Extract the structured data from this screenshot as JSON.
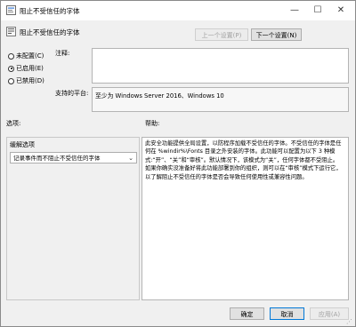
{
  "window_title": "阻止不受信任的字体",
  "window_controls": {
    "minimize": "—",
    "maximize": "☐",
    "close": "✕"
  },
  "header_title": "阻止不受信任的字体",
  "nav": {
    "prev_label": "上一个设置(P)",
    "next_label": "下一个设置(N)"
  },
  "options": [
    {
      "label": "未配置(C)",
      "selected": false
    },
    {
      "label": "已启用(E)",
      "selected": true
    },
    {
      "label": "已禁用(D)",
      "selected": false
    }
  ],
  "comment_label": "注释:",
  "comment_value": "",
  "supported_label": "支持的平台:",
  "supported_value": "至少为 Windows Server 2016、Windows 10",
  "options_section_label": "选项:",
  "help_section_label": "帮助:",
  "mitigation_label": "缓解选项",
  "mitigation_selected": "记录事件而不阻止不受信任的字体",
  "help_text": "此安全功能提供全局设置，以防程序加载不受信任的字体。不受信任的字体是任何在 %windir%\\Fonts 目录之外安装的字体。此功能可以配置为以下 3 种模式:“开”、“关”和“审核”。默认情况下，该模式为“关”，任何字体都不受阻止。如果你确实没准备好将此功能部署到你的组织，则可以在“审核”模式下运行它，以了解阻止不受信任的字体是否会导致任何使用性或兼容性问题。",
  "footer": {
    "ok_label": "确定",
    "cancel_label": "取消",
    "apply_label": "应用(A)"
  },
  "icons": {
    "title_icon": "policy-icon",
    "header_icon": "setting-icon",
    "dropdown": "chevron-down-icon"
  },
  "colors": {
    "accent_border": "#0078d7",
    "window_bg": "#f0f0f0"
  }
}
